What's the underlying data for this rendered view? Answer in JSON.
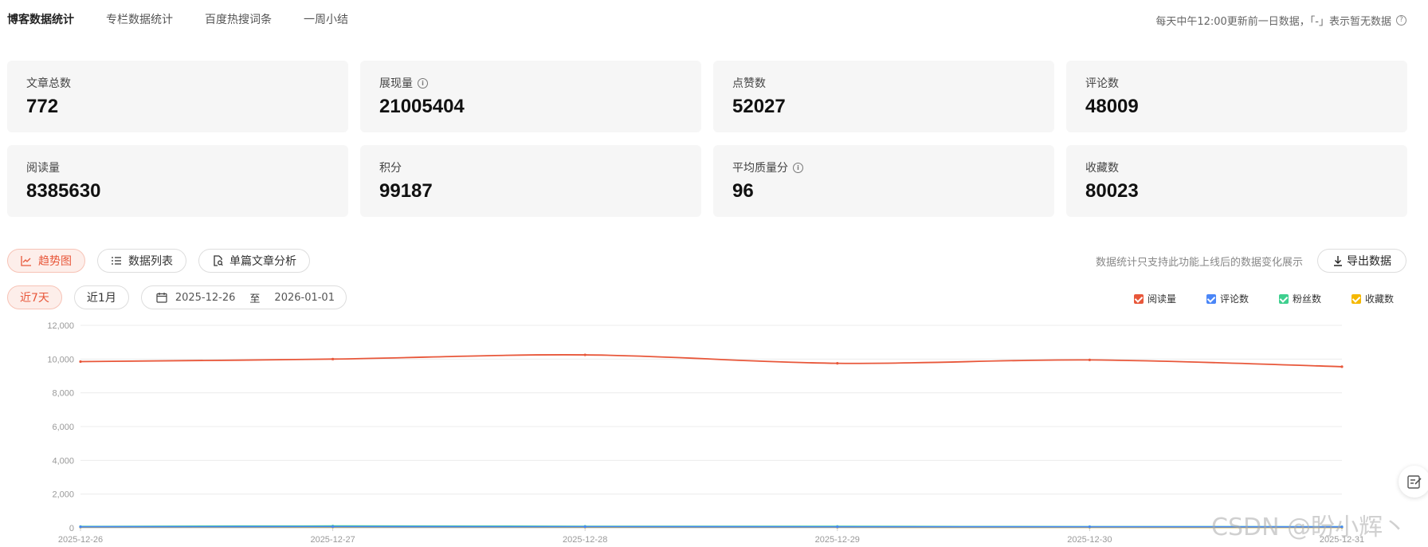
{
  "tabs": [
    {
      "label": "博客数据统计",
      "active": true
    },
    {
      "label": "专栏数据统计",
      "active": false
    },
    {
      "label": "百度热搜词条",
      "active": false
    },
    {
      "label": "一周小结",
      "active": false
    }
  ],
  "notice": "每天中午12:00更新前一日数据，「-」表示暂无数据",
  "stats": [
    {
      "label": "文章总数",
      "value": "772",
      "info": false
    },
    {
      "label": "展现量",
      "value": "21005404",
      "info": true
    },
    {
      "label": "点赞数",
      "value": "52027",
      "info": false
    },
    {
      "label": "评论数",
      "value": "48009",
      "info": false
    },
    {
      "label": "阅读量",
      "value": "8385630",
      "info": false
    },
    {
      "label": "积分",
      "value": "99187",
      "info": false
    },
    {
      "label": "平均质量分",
      "value": "96",
      "info": true
    },
    {
      "label": "收藏数",
      "value": "80023",
      "info": false
    }
  ],
  "toolbar": {
    "trend_label": "趋势图",
    "list_label": "数据列表",
    "single_label": "单篇文章分析",
    "note": "数据统计只支持此功能上线后的数据变化展示",
    "export_label": "导出数据"
  },
  "range": {
    "week_label": "近7天",
    "month_label": "近1月",
    "start_date": "2025-12-26",
    "separator": "至",
    "end_date": "2026-01-01"
  },
  "colors": {
    "accent": "#e8573a",
    "read": "#e8573a",
    "comment": "#4a86f7",
    "fans": "#3ecf8e",
    "collect": "#f5b800"
  },
  "watermark": "CSDN @盼小辉丶",
  "chart_data": {
    "type": "line",
    "categories": [
      "2025-12-26",
      "2025-12-27",
      "2025-12-28",
      "2025-12-29",
      "2025-12-30",
      "2025-12-31"
    ],
    "ylim": [
      0,
      12000
    ],
    "yticks": [
      "0",
      "2,000",
      "4,000",
      "6,000",
      "8,000",
      "10,000",
      "12,000"
    ],
    "grid": true,
    "legend_position": "top-right",
    "series": [
      {
        "name": "阅读量",
        "color": "#e8573a",
        "values": [
          9850,
          10000,
          10250,
          9750,
          9950,
          9550
        ]
      },
      {
        "name": "评论数",
        "color": "#4a86f7",
        "values": [
          60,
          70,
          65,
          60,
          60,
          55
        ]
      },
      {
        "name": "粉丝数",
        "color": "#3ecf8e",
        "values": [
          80,
          110,
          90,
          85,
          70,
          65
        ]
      },
      {
        "name": "收藏数",
        "color": "#f5b800",
        "values": [
          40,
          50,
          45,
          40,
          35,
          30
        ]
      }
    ]
  }
}
